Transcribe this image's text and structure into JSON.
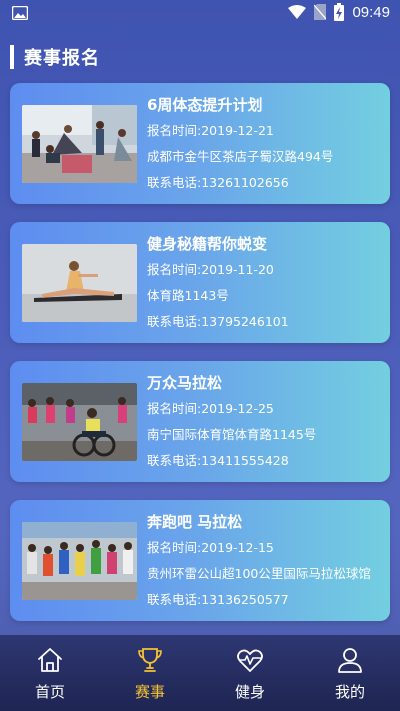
{
  "status_bar": {
    "time": "09:49"
  },
  "section": {
    "title": "赛事报名"
  },
  "events": [
    {
      "title": "6周体态提升计划",
      "time": "报名时间:2019-12-21",
      "address": "成都市金牛区茶店子蜀汉路494号",
      "phone": "联系电话:13261102656"
    },
    {
      "title": "健身秘籍帮你蜕变",
      "time": "报名时间:2019-11-20",
      "address": "体育路1143号",
      "phone": "联系电话:13795246101"
    },
    {
      "title": "万众马拉松",
      "time": "报名时间:2019-12-25",
      "address": "南宁国际体育馆体育路1145号",
      "phone": "联系电话:13411555428"
    },
    {
      "title": "奔跑吧 马拉松",
      "time": "报名时间:2019-12-15",
      "address": "贵州环雷公山超100公里国际马拉松球馆",
      "phone": "联系电话:13136250577"
    }
  ],
  "tabs": [
    {
      "label": "首页",
      "icon": "home-icon"
    },
    {
      "label": "赛事",
      "icon": "trophy-icon",
      "active": true
    },
    {
      "label": "健身",
      "icon": "heart-pulse-icon"
    },
    {
      "label": "我的",
      "icon": "user-icon"
    }
  ],
  "colors": {
    "active_tab": "#f5c232",
    "card_start": "#5e8df0",
    "card_end": "#73cfe0"
  }
}
